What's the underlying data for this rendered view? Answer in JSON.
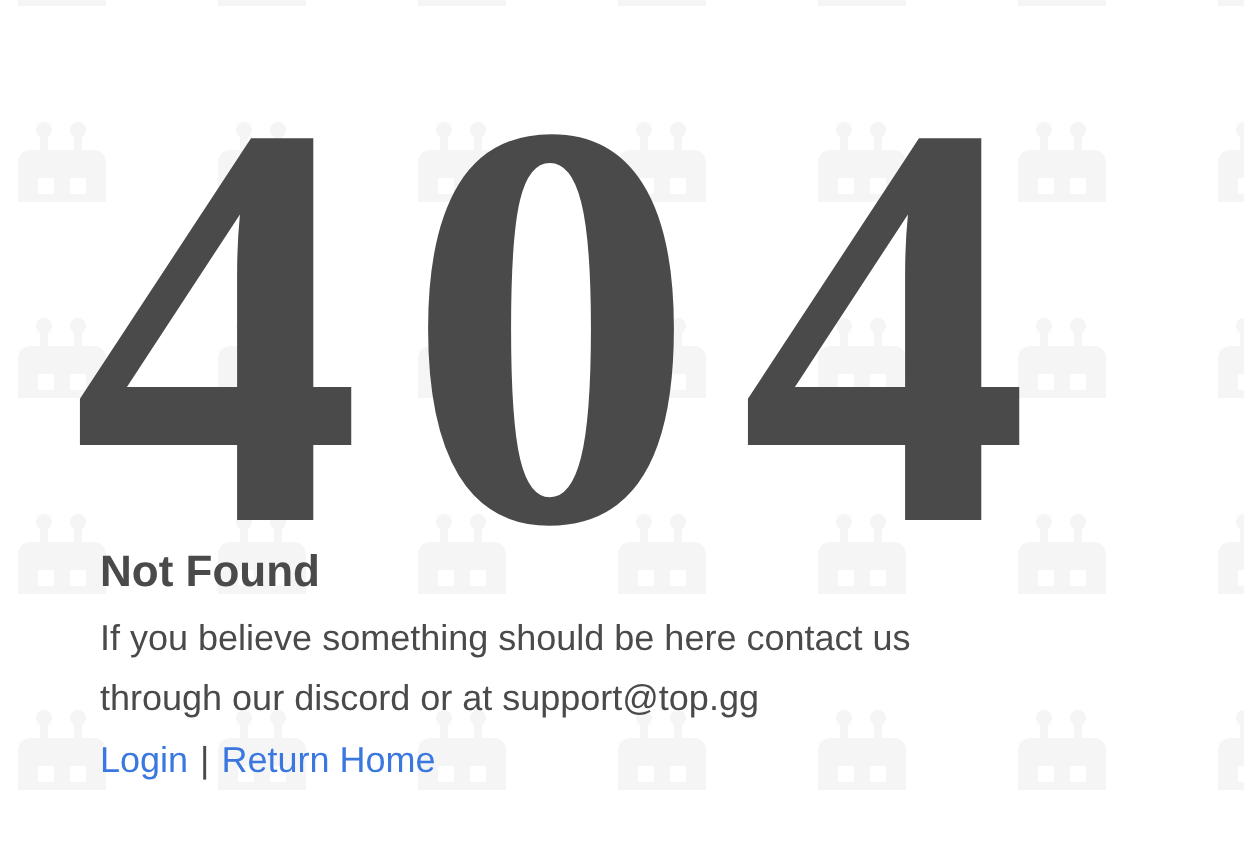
{
  "error_code": "404",
  "title": "Not Found",
  "message": "If you believe something should be here contact us through our discord or at support@top.gg",
  "links": [
    {
      "label": "Login"
    },
    {
      "label": "Return Home"
    }
  ],
  "link_separator": "|"
}
